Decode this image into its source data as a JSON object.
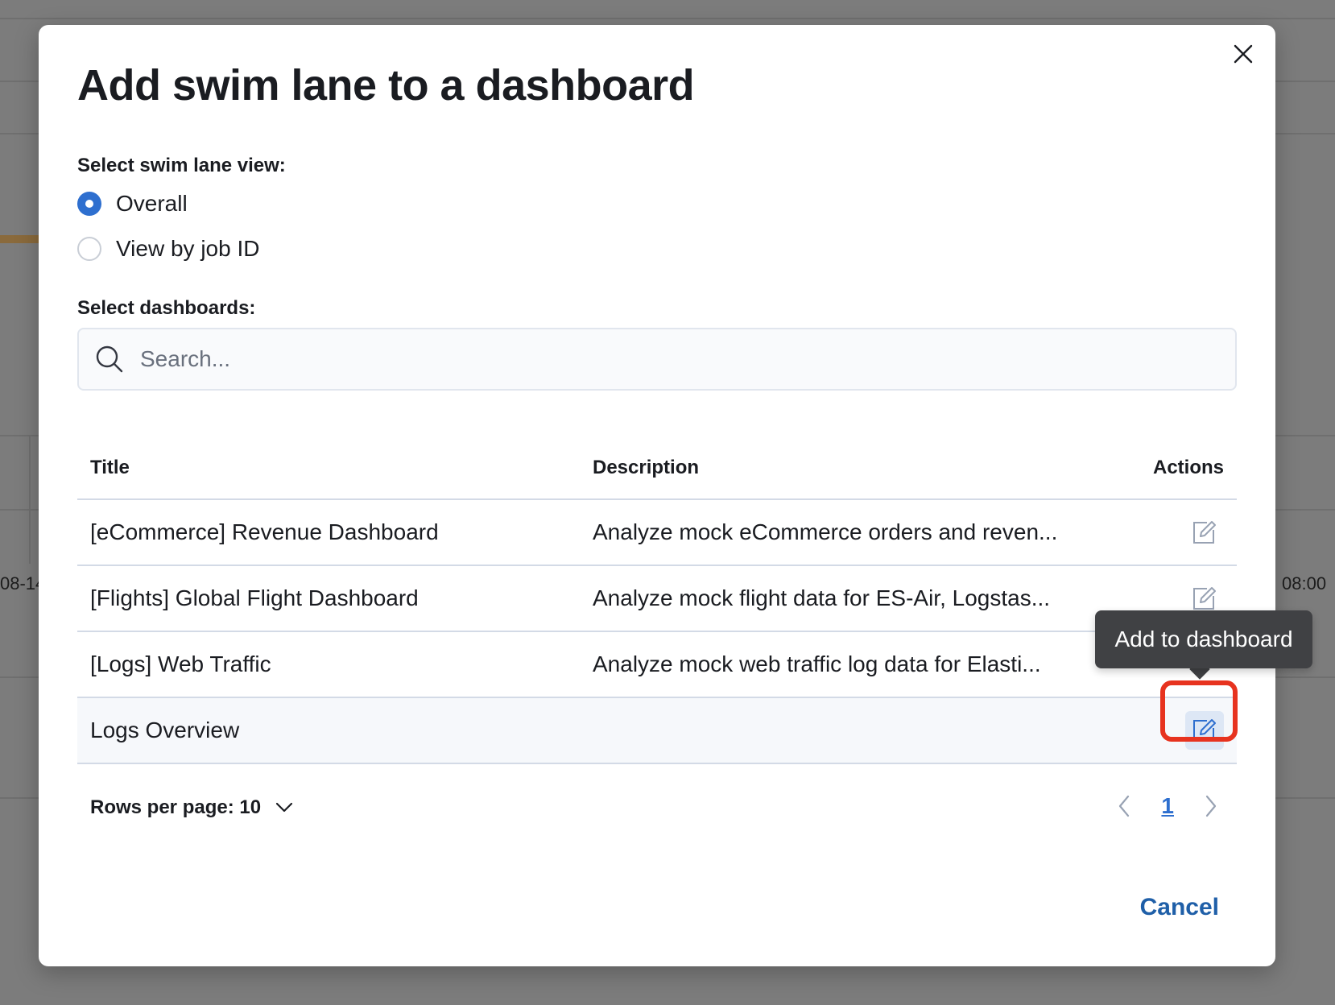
{
  "background": {
    "label_left": "08-14",
    "label_right": "08:00"
  },
  "modal": {
    "title": "Add swim lane to a dashboard",
    "swim_lane_label": "Select swim lane view:",
    "swim_lane_options": [
      {
        "label": "Overall",
        "checked": true
      },
      {
        "label": "View by job ID",
        "checked": false
      }
    ],
    "dashboards_label": "Select dashboards:",
    "search": {
      "placeholder": "Search...",
      "value": ""
    },
    "table": {
      "headers": {
        "title": "Title",
        "description": "Description",
        "actions": "Actions"
      },
      "rows": [
        {
          "title": "[eCommerce] Revenue Dashboard",
          "description": "Analyze mock eCommerce orders and reven..."
        },
        {
          "title": "[Flights] Global Flight Dashboard",
          "description": "Analyze mock flight data for ES-Air, Logstas..."
        },
        {
          "title": "[Logs] Web Traffic",
          "description": "Analyze mock web traffic log data for Elasti..."
        },
        {
          "title": "Logs Overview",
          "description": ""
        }
      ]
    },
    "tooltip": "Add to dashboard",
    "rows_per_page": "Rows per page: 10",
    "current_page": "1",
    "cancel_label": "Cancel"
  },
  "colors": {
    "primary": "#2e6fcf",
    "cancel": "#1f5fa8",
    "highlight": "#e7331f",
    "tooltip_bg": "#404144"
  }
}
